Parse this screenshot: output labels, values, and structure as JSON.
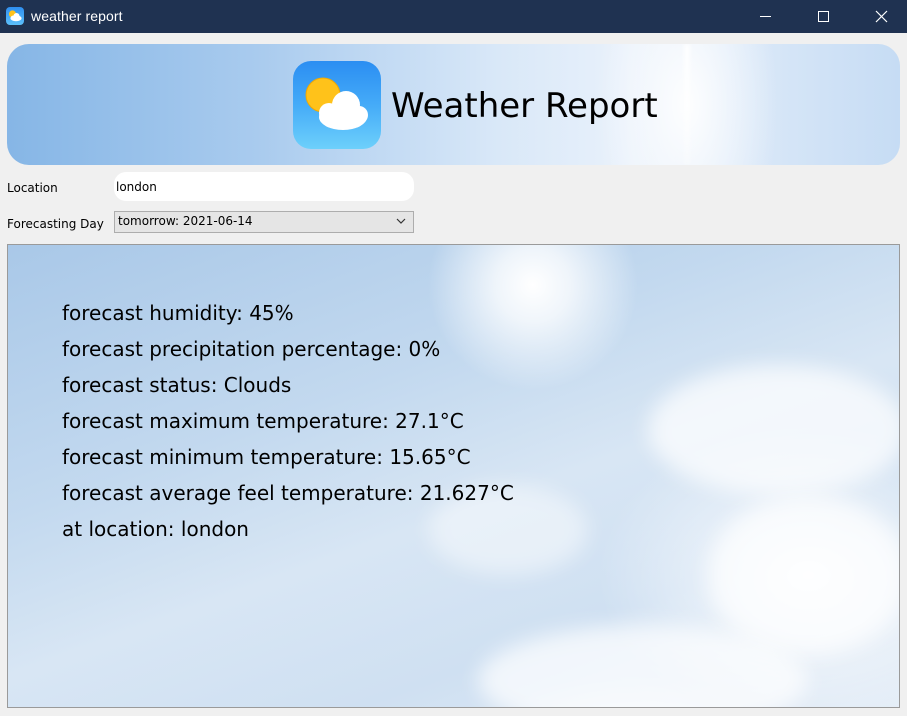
{
  "window": {
    "title": "weather report"
  },
  "banner": {
    "title": "Weather Report"
  },
  "form": {
    "location_label": "Location",
    "location_value": "london",
    "day_label": "Forecasting Day",
    "day_selected": "tomorrow: 2021-06-14"
  },
  "forecast": {
    "lines": [
      "forecast humidity: 45%",
      "forecast precipitation percentage: 0%",
      "forecast status: Clouds",
      "forecast maximum temperature: 27.1°C",
      "forecast minimum temperature: 15.65°C",
      "forecast average feel temperature: 21.627°C",
      "at location: london"
    ]
  },
  "colors": {
    "titlebar": "#1f3251",
    "logo_top": "#2b8ef2",
    "logo_bottom": "#6dd0fb",
    "sun": "#ffc21a"
  },
  "icons": {
    "app": "weather-sun-cloud-icon",
    "minimize": "minimize-icon",
    "maximize": "maximize-icon",
    "close": "close-icon",
    "dropdown": "chevron-down-icon"
  }
}
